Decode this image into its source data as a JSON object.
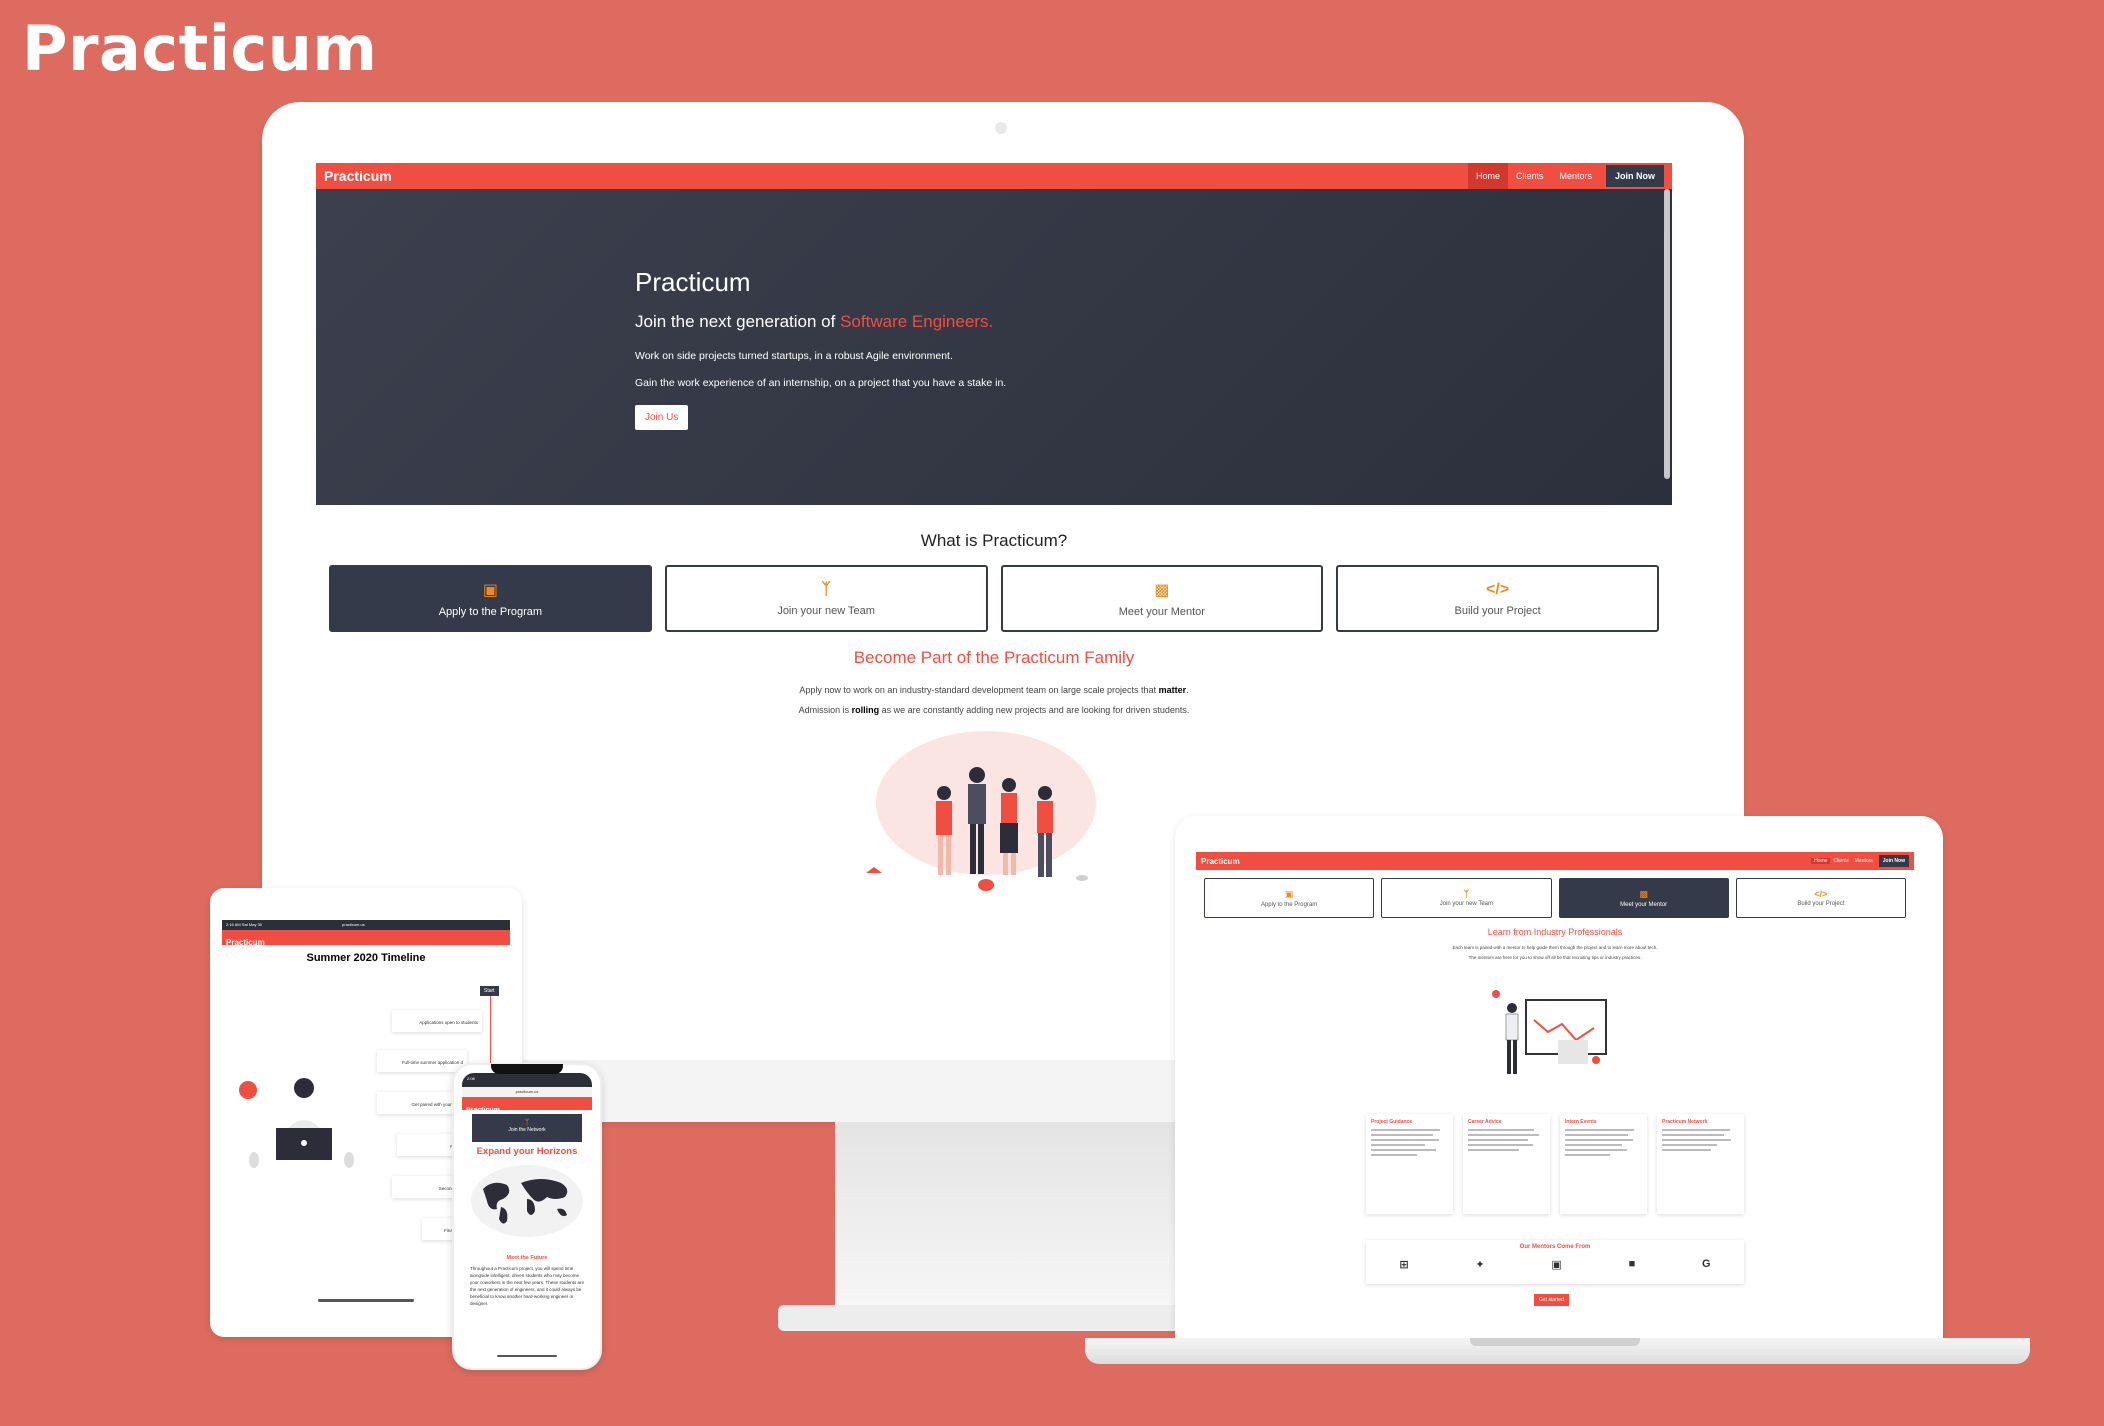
{
  "brand": "Practicum",
  "desktop": {
    "logo": "Practicum",
    "nav": [
      "Home",
      "Clients",
      "Mentors"
    ],
    "nav_cta": "Join Now",
    "hero": {
      "title": "Practicum",
      "subtitle_prefix": "Join the next generation of ",
      "subtitle_accent": "Software Engineers.",
      "line1": "Work on side projects turned startups, in a robust Agile environment.",
      "line2": "Gain the work experience of an internship, on a project that you have a stake in.",
      "button": "Join Us"
    },
    "section_title": "What is Practicum?",
    "features": [
      {
        "icon": "clipboard-icon",
        "label": "Apply to the Program"
      },
      {
        "icon": "branch-icon",
        "label": "Join your new Team"
      },
      {
        "icon": "mentor-icon",
        "label": "Meet your Mentor"
      },
      {
        "icon": "code-icon",
        "label": "Build your Project"
      }
    ],
    "family_title": "Become Part of the Practicum Family",
    "family_line1_a": "Apply now to work on an industry-standard development team on large scale projects that ",
    "family_line1_b": "matter",
    "family_line1_c": ".",
    "family_line2_a": "Admission is ",
    "family_line2_b": "rolling",
    "family_line2_c": " as we are constantly adding new projects and are looking for driven students."
  },
  "laptop": {
    "logo": "Practicum",
    "nav": [
      "Home",
      "Clients",
      "Mentors"
    ],
    "nav_cta": "Join Now",
    "features": [
      "Apply to the Program",
      "Join your new Team",
      "Meet your Mentor",
      "Build your Project"
    ],
    "title": "Learn from Industry Professionals",
    "sub1": "Each team is paired with a mentor to help guide them through the project and to learn more about tech.",
    "sub2": "The mentors are here for you to show off all be that recruiting tips or industry practices.",
    "cards": [
      "Project Guidance",
      "Career Advice",
      "Intern Events",
      "Practicum Network"
    ],
    "mentors_title": "Our Mentors Come From",
    "get_started": "Get started"
  },
  "tablet": {
    "status": "2:16 AM  Sat May 30",
    "url": "practicum.us",
    "logo": "Practicum",
    "title": "Summer 2020 Timeline",
    "start": "Start",
    "events": [
      "Applications open to students",
      "Full-time summer application d",
      "Get paired with your team",
      "First Community",
      "Second Community",
      "Final S"
    ]
  },
  "phone": {
    "time": "2:08",
    "url": "practicum.us",
    "logo": "Practicum",
    "network": "Join the Network",
    "title": "Expand your Horizons",
    "meet": "Meet the Future",
    "text": "Throughout a Practicum project, you will spend time alongside intelligent, driven students who may become your coworkers in the next few years. These students are the next generation of engineers, and it could always be beneficial to know another hard-working engineer or designer."
  },
  "colors": {
    "accent": "#ef4e41",
    "dark": "#343a4a",
    "background": "#de6b5f",
    "icon": "#f08a1e"
  }
}
